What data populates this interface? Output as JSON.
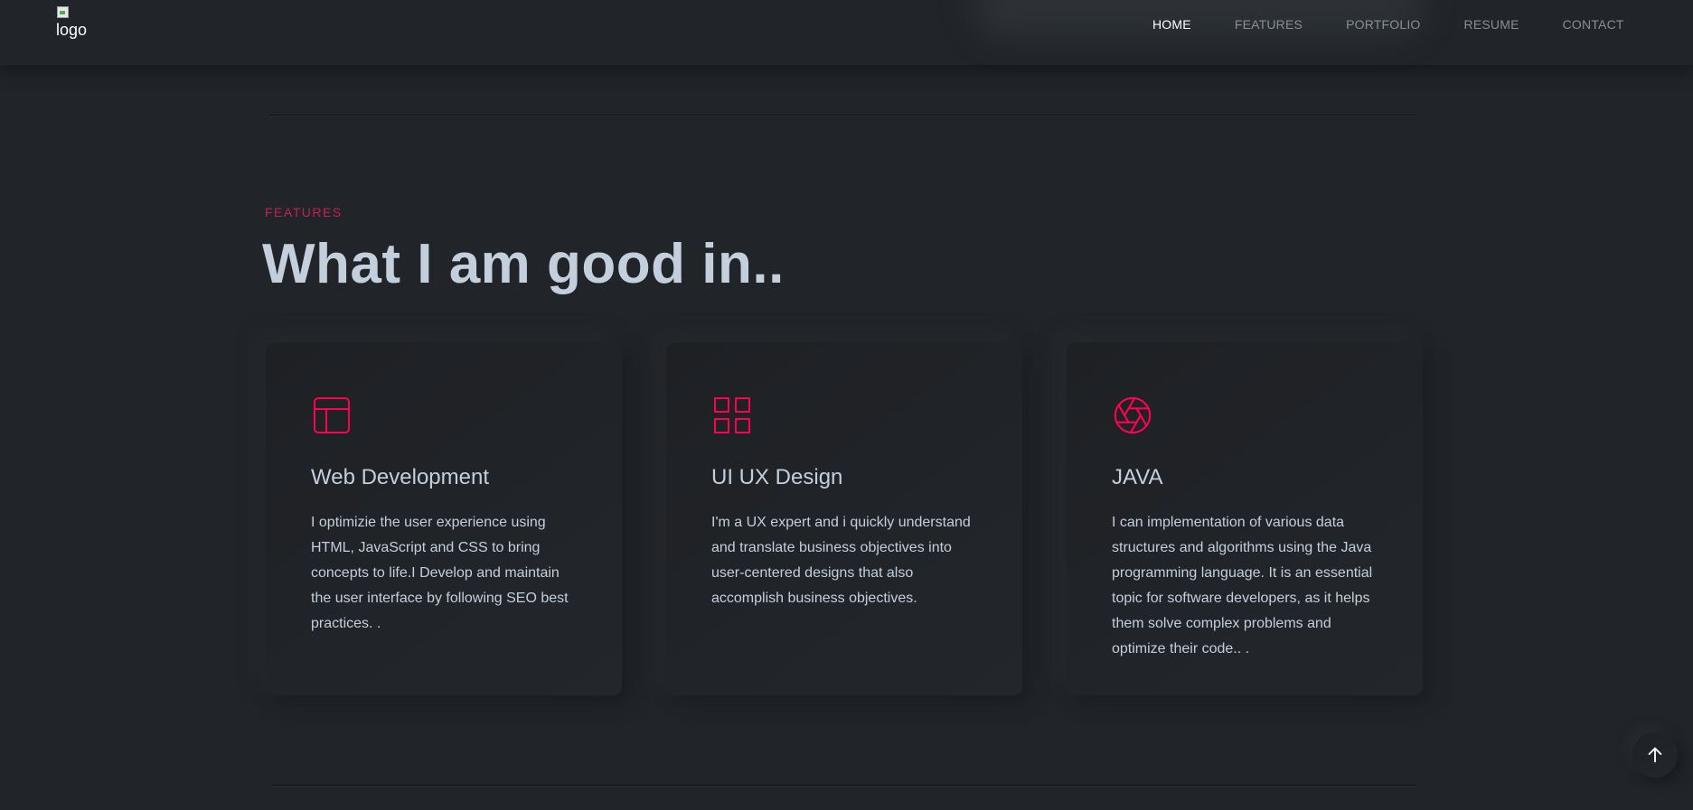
{
  "header": {
    "logo_alt": "logo",
    "nav": [
      {
        "label": "HOME",
        "active": true
      },
      {
        "label": "FEATURES",
        "active": false
      },
      {
        "label": "PORTFOLIO",
        "active": false
      },
      {
        "label": "RESUME",
        "active": false
      },
      {
        "label": "CONTACT",
        "active": false
      }
    ]
  },
  "features": {
    "subtitle": "FEATURES",
    "title": "What I am good in..",
    "cards": [
      {
        "icon": "layout-icon",
        "title": "Web Development",
        "description": "I optimizie the user experience using HTML, JavaScript and CSS to bring concepts to life.I Develop and maintain the user interface by following SEO best practices. ."
      },
      {
        "icon": "grid-icon",
        "title": "UI UX Design",
        "description": "I'm a UX expert and i quickly understand and translate business objectives into user-centered designs that also accomplish business objectives."
      },
      {
        "icon": "aperture-icon",
        "title": "JAVA",
        "description": "I can implementation of various data structures and algorithms using the Java programming language. It is an essential topic for software developers, as it helps them solve complex problems and optimize their code.. ."
      }
    ]
  },
  "colors": {
    "background": "#212428",
    "accent": "#ff014f",
    "heading": "#c4cfde",
    "nav_inactive": "#8a8f96",
    "nav_active": "#ffffff"
  },
  "back_to_top": {
    "icon": "arrow-up-icon"
  }
}
